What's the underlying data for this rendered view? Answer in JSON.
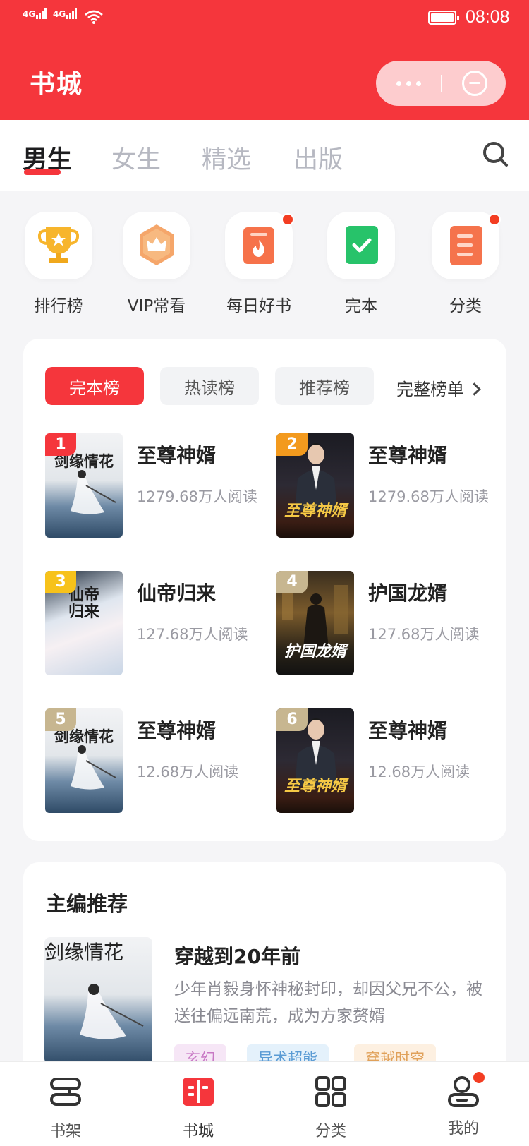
{
  "status_bar": {
    "signal_1": "4G",
    "signal_2": "4G",
    "time": "08:08"
  },
  "header": {
    "title": "书城"
  },
  "tabs": [
    {
      "label": "男生",
      "active": true
    },
    {
      "label": "女生",
      "active": false
    },
    {
      "label": "精选",
      "active": false
    },
    {
      "label": "出版",
      "active": false
    }
  ],
  "entries": [
    {
      "label": "排行榜",
      "icon": "trophy-icon",
      "badge": false
    },
    {
      "label": "VIP常看",
      "icon": "vip-crown-icon",
      "badge": false
    },
    {
      "label": "每日好书",
      "icon": "daily-book-icon",
      "badge": true
    },
    {
      "label": "完本",
      "icon": "finished-check-icon",
      "badge": false
    },
    {
      "label": "分类",
      "icon": "category-list-icon",
      "badge": true
    }
  ],
  "ranking": {
    "tabs": [
      {
        "label": "完本榜",
        "active": true
      },
      {
        "label": "热读榜",
        "active": false
      },
      {
        "label": "推荐榜",
        "active": false
      }
    ],
    "full_list": "完整榜单",
    "books": [
      {
        "rank": "1",
        "title": "至尊神婿",
        "reads": "1279.68万人阅读",
        "cover_text": "剑缘情花",
        "badge_color": "#f5363c"
      },
      {
        "rank": "2",
        "title": "至尊神婿",
        "reads": "1279.68万人阅读",
        "cover_text": "至尊神婿",
        "badge_color": "#f39a1e"
      },
      {
        "rank": "3",
        "title": "仙帝归来",
        "reads": "127.68万人阅读",
        "cover_text": "仙帝归来",
        "badge_color": "#f7c21b"
      },
      {
        "rank": "4",
        "title": "护国龙婿",
        "reads": "127.68万人阅读",
        "cover_text": "护国龙婿",
        "badge_color": "#c7b690"
      },
      {
        "rank": "5",
        "title": "至尊神婿",
        "reads": "12.68万人阅读",
        "cover_text": "剑缘情花",
        "badge_color": "#c7b690"
      },
      {
        "rank": "6",
        "title": "至尊神婿",
        "reads": "12.68万人阅读",
        "cover_text": "至尊神婿",
        "badge_color": "#c7b690"
      }
    ]
  },
  "editor": {
    "section_title": "主编推荐",
    "book_title": "穿越到20年前",
    "description": "少年肖毅身怀神秘封印，却因父兄不公，被送往偏远南荒，成为方家赘婿",
    "cover_text": "剑缘情花",
    "tags": [
      "玄幻",
      "异术超能",
      "穿越时空"
    ]
  },
  "bottom_nav": [
    {
      "label": "书架",
      "icon": "bookshelf-icon",
      "active": false,
      "badge": false
    },
    {
      "label": "书城",
      "icon": "bookstore-icon",
      "active": true,
      "badge": false
    },
    {
      "label": "分类",
      "icon": "category-grid-icon",
      "active": false,
      "badge": false
    },
    {
      "label": "我的",
      "icon": "profile-icon",
      "active": false,
      "badge": true
    }
  ],
  "colors": {
    "brand": "#f5363c",
    "badge": "#f33d22"
  }
}
